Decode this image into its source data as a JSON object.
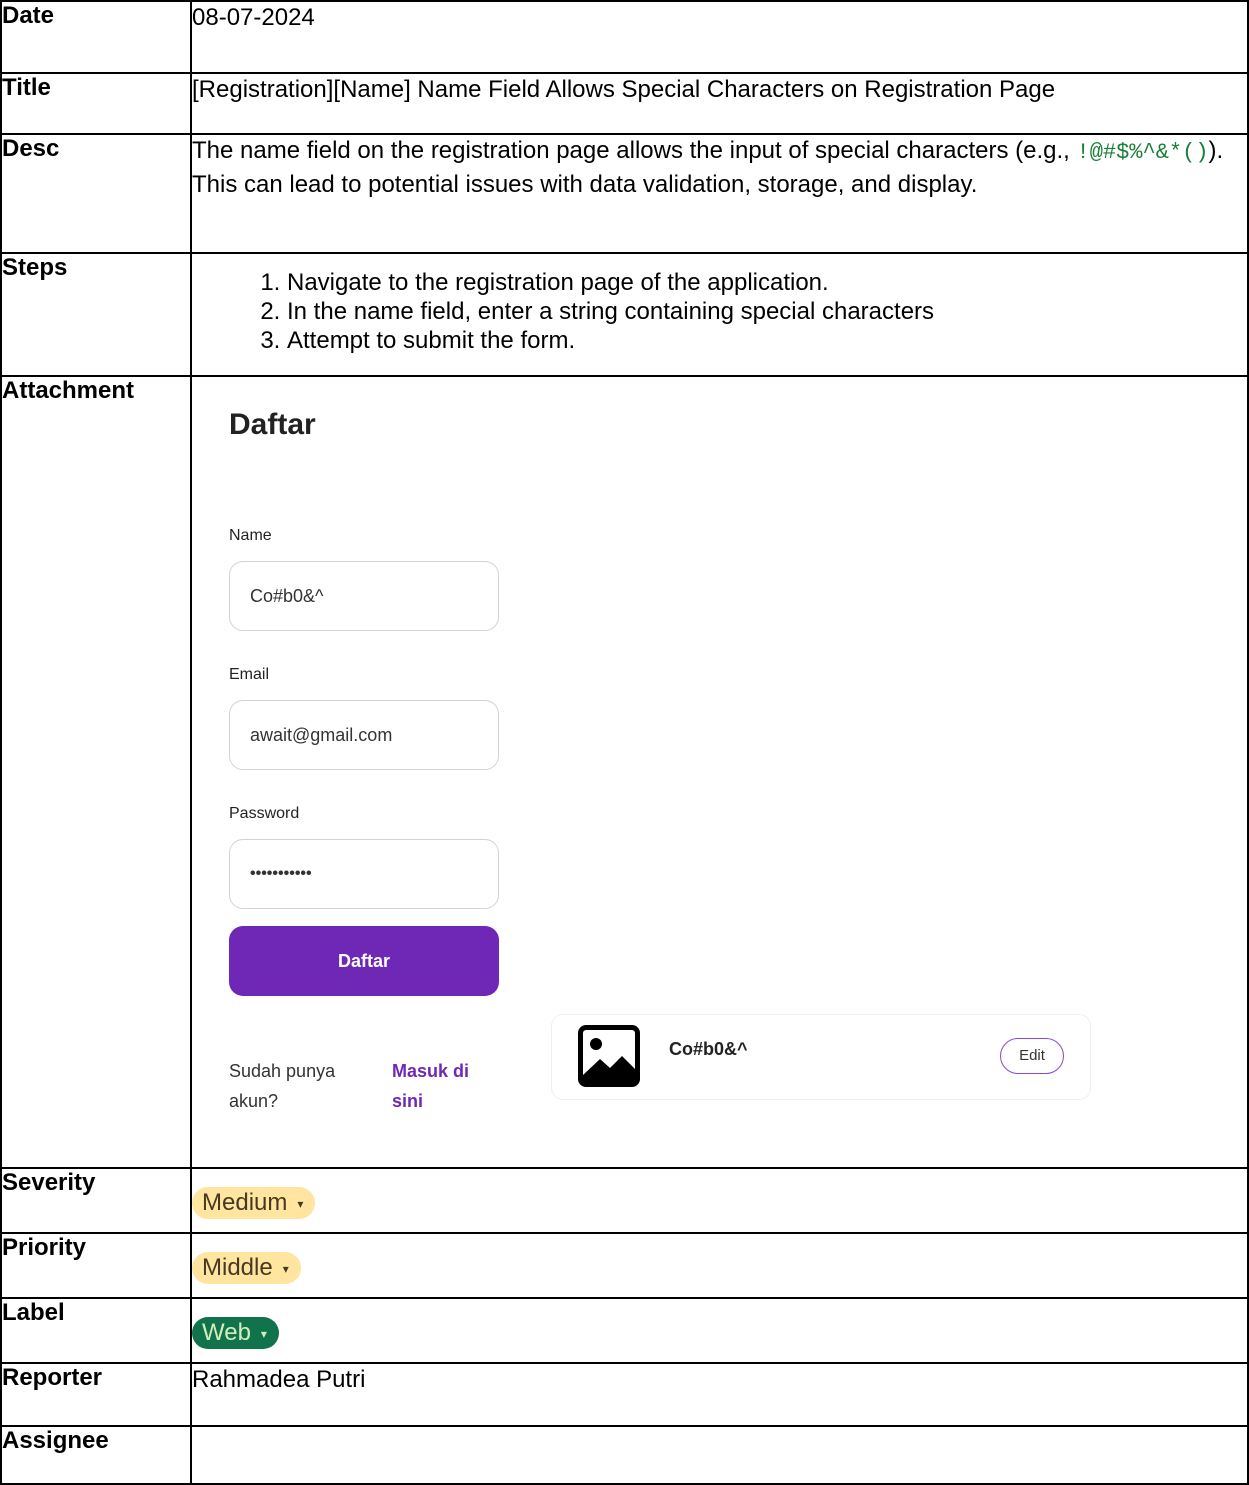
{
  "rows": {
    "date": {
      "key": "Date",
      "value": "08-07-2024"
    },
    "title": {
      "key": "Title",
      "value": "[Registration][Name] Name Field Allows Special Characters on Registration Page"
    },
    "desc": {
      "key": "Desc",
      "before": "The name field on the registration page allows the input of special characters (e.g., ",
      "code": "!@#$%^&*()",
      "after": "). This can lead to potential issues with data validation, storage, and display."
    },
    "steps": {
      "key": "Steps",
      "items": [
        "Navigate to the registration page of the application.",
        "In the name field, enter a string containing special characters",
        "Attempt to submit the form."
      ]
    },
    "attachment": {
      "key": "Attachment"
    },
    "severity": {
      "key": "Severity",
      "value": "Medium",
      "color": "#ffe5a0"
    },
    "priority": {
      "key": "Priority",
      "value": "Middle",
      "color": "#ffe5a0"
    },
    "label": {
      "key": "Label",
      "value": "Web",
      "color": "#11734b",
      "text_color": "#d4edbc"
    },
    "reporter": {
      "key": "Reporter",
      "value": "Rahmadea Putri"
    },
    "assignee": {
      "key": "Assignee",
      "value": ""
    }
  },
  "attachment": {
    "heading": "Daftar",
    "name_label": "Name",
    "name_value": "Co#b0&^",
    "email_label": "Email",
    "email_value": "await@gmail.com",
    "password_label": "Password",
    "password_value": "•••••••••••",
    "submit_label": "Daftar",
    "question": "Sudah punya akun?",
    "login_link": "Masuk di sini",
    "card_name": "Co#b0&^",
    "card_edit": "Edit",
    "image_icon": "image-icon"
  }
}
